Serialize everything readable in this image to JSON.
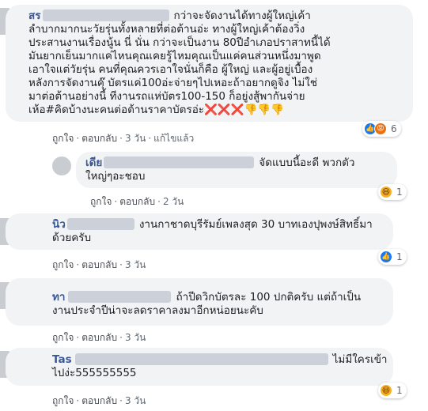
{
  "comments": [
    {
      "name_visible": "สร",
      "lines": [
        "กว่าจะจัดงานได้ทางผู้ใหญ่เค้า",
        "ลำบากมากนะวัยรุ่นทั้งหลายที่ต่อต้านอ่ะ ทางผู้ใหญ่เค้าต้องวิ่ง",
        "ประสานงานเรื่องนู้น นี่ นั่น กว่าจะเป็นงาน 80ปีอำเภอปราสาทนี้ได้",
        "มันยากเย็นมากแค่ไหนคุณเคยรู้ไหมคุณเป็นแค่คนส่วนหนึ่งมาพูด",
        "เอาใจแต่วัยรุ่น คนที่คุณควรเอาใจนั่นก็คือ ผู้ใหญ่ และผู้อยู่เบื้อง",
        "หลังการจัดงานคุ๊ บัตรแค่100อ่ะจ่ายๆไปเหอะถ้าอยากดูจิง ไม่ใช่",
        "มาต่อต้านอย่างนี้ ทีงานรถแห่บัตร100-150 ก็อยู่งสู้พากันจ่าย",
        "เห้อ#คิดบ้างนะคนต่อต้านราคาบัตรอ่ะ"
      ],
      "emoji_tail": "❌❌❌👎👎👎",
      "reaction_count": "6",
      "actions": {
        "like": "ถูกใจ",
        "reply": "ตอบกลับ",
        "time": "3 วัน",
        "edited": "แก้ไขแล้ว"
      }
    },
    {
      "name_visible": "เดีย",
      "lines": [
        "จัดแบบนี้อะดี พวกตัว",
        "ใหญ่ๆอะชอบ"
      ],
      "reaction_count": "1",
      "actions": {
        "like": "ถูกใจ",
        "reply": "ตอบกลับ",
        "time": "2 วัน"
      }
    },
    {
      "name_visible": "นิว",
      "lines": [
        "งานกาชาดบุรีรัมย์เพลงสุด 30 บาทเองปุพงษ์สิทธิ์มา",
        "ด้วยครับ"
      ],
      "reaction_count": "1",
      "actions": {
        "like": "ถูกใจ",
        "reply": "ตอบกลับ",
        "time": "3 วัน"
      }
    },
    {
      "name_visible": "ทา",
      "lines": [
        "ถ้าปีดวิกบัตรละ 100 ปกติครับ แต่ถ้าเป็น",
        "งานประจำปีน่าจะลดราคาลงมาอีกหน่อยนะคับ"
      ],
      "actions": {
        "like": "ถูกใจ",
        "reply": "ตอบกลับ",
        "time": "3 วัน"
      }
    },
    {
      "name_visible": "Tas",
      "lines": [
        "ไม่มีใครเข้า",
        "ไปง่ะ555555555"
      ],
      "reaction_count": "1",
      "actions": {
        "like": "ถูกใจ",
        "reply": "ตอบกลับ",
        "time": "3 วัน"
      }
    }
  ]
}
